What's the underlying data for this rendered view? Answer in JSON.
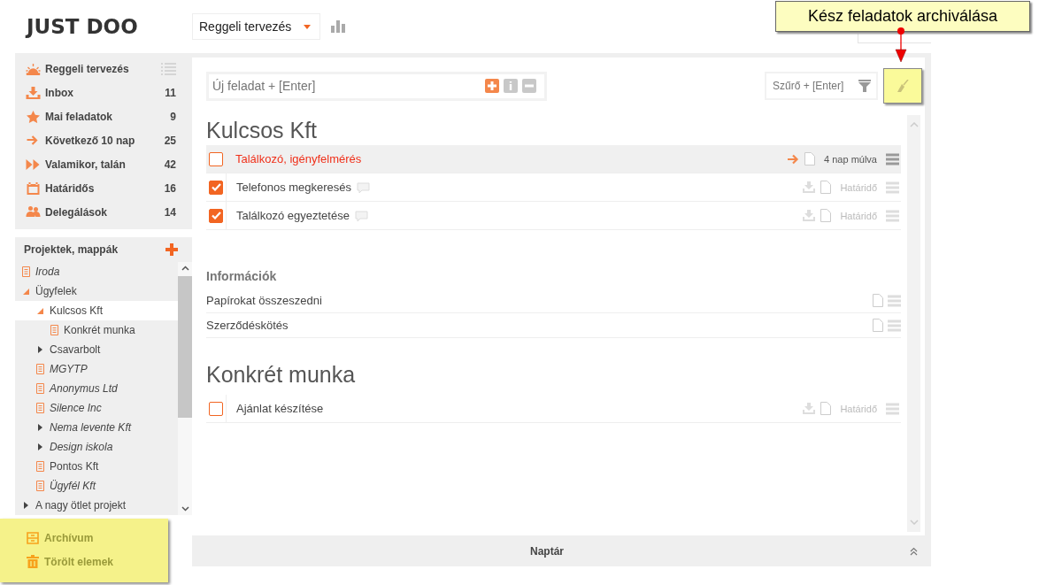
{
  "logo": "JUST DOO",
  "view_select": {
    "value": "Reggeli tervezés"
  },
  "callout": {
    "text": "Kész feladatok archiválása"
  },
  "sidebar": {
    "nav": [
      {
        "label": "Reggeli tervezés"
      },
      {
        "label": "Inbox",
        "count": "11"
      },
      {
        "label": "Mai feladatok",
        "count": "9"
      },
      {
        "label": "Következő 10 nap",
        "count": "25"
      },
      {
        "label": "Valamikor, talán",
        "count": "42"
      },
      {
        "label": "Határidős",
        "count": "16"
      },
      {
        "label": "Delegálások",
        "count": "14"
      }
    ],
    "projects": {
      "title": "Projektek, mappák",
      "items": [
        {
          "label": "Iroda",
          "kind": "list",
          "italic": true
        },
        {
          "label": "Ügyfelek",
          "kind": "folder",
          "italic": false,
          "expanded": true,
          "selected": false,
          "children": [
            {
              "label": "Kulcsos Kft",
              "kind": "folder",
              "italic": false,
              "expanded": true,
              "selected": true,
              "children": [
                {
                  "label": "Konkrét munka",
                  "kind": "list",
                  "italic": false
                }
              ]
            },
            {
              "label": "Csavarbolt",
              "kind": "folder",
              "italic": false,
              "expanded": false,
              "selected": false
            },
            {
              "label": "MGYTP",
              "kind": "list",
              "italic": true
            },
            {
              "label": "Anonymus Ltd",
              "kind": "list",
              "italic": true
            },
            {
              "label": "Silence Inc",
              "kind": "list",
              "italic": true
            },
            {
              "label": "Nema levente Kft",
              "kind": "folder",
              "italic": true,
              "expanded": false,
              "selected": false
            },
            {
              "label": "Design iskola",
              "kind": "folder",
              "italic": true,
              "expanded": false,
              "selected": false
            },
            {
              "label": "Pontos Kft",
              "kind": "list",
              "italic": false
            },
            {
              "label": "Ügyfél Kft",
              "kind": "list",
              "italic": true
            }
          ]
        },
        {
          "label": "A nagy ötlet projekt",
          "kind": "folder",
          "italic": false,
          "expanded": false,
          "selected": false
        }
      ]
    },
    "bottom": [
      {
        "label": "Archívum"
      },
      {
        "label": "Törölt elemek"
      }
    ]
  },
  "new_task": {
    "placeholder": "Új feladat + [Enter]"
  },
  "filter": {
    "placeholder": "Szűrő + [Enter]"
  },
  "sections": [
    {
      "kind": "tasks",
      "title": "Kulcsos Kft",
      "items": [
        {
          "title": "Találkozó, igényfelmérés",
          "checked": false,
          "selected": true,
          "comment": false,
          "due": "4 nap múlva",
          "due_set": true
        },
        {
          "title": "Telefonos megkeresés",
          "checked": true,
          "selected": false,
          "comment": true,
          "due": "Határidő",
          "due_set": false
        },
        {
          "title": "Találkozó egyeztetése",
          "checked": true,
          "selected": false,
          "comment": true,
          "due": "Határidő",
          "due_set": false
        }
      ]
    },
    {
      "kind": "info",
      "title": "Információk",
      "items": [
        {
          "title": "Papírokat összeszedni"
        },
        {
          "title": "Szerződéskötés"
        }
      ]
    },
    {
      "kind": "tasks",
      "title": "Konkrét munka",
      "items": [
        {
          "title": "Ajánlat készítése",
          "checked": false,
          "selected": false,
          "comment": false,
          "due": "Határidő",
          "due_set": false
        }
      ]
    }
  ],
  "calendar_bar": {
    "label": "Naptár"
  }
}
